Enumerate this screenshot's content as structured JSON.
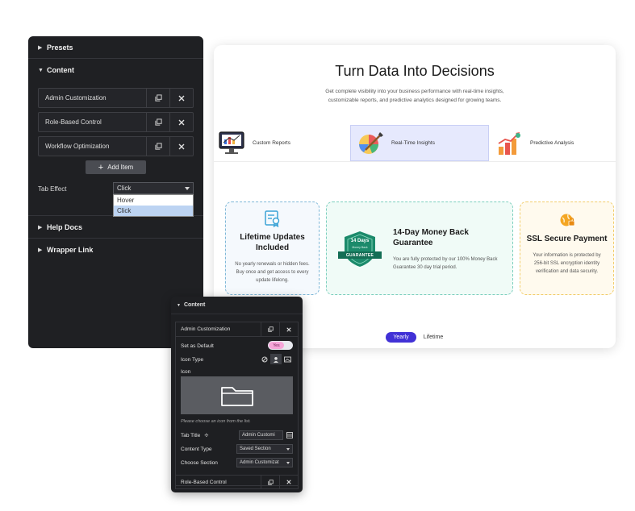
{
  "editor": {
    "sections": {
      "presets": "Presets",
      "content": "Content",
      "help_docs": "Help Docs",
      "wrapper_link": "Wrapper Link"
    },
    "items": [
      {
        "label": "Admin Customization"
      },
      {
        "label": "Role-Based Control"
      },
      {
        "label": "Workflow Optimization"
      }
    ],
    "add_item_label": "Add Item",
    "tab_effect": {
      "label": "Tab Effect",
      "value": "Click",
      "options": [
        "Hover",
        "Click"
      ]
    }
  },
  "preview": {
    "title": "Turn Data Into Decisions",
    "subtitle": "Get complete visibility into your business performance with real-time insights, customizable reports, and predictive analytics designed for growing teams.",
    "tabs": [
      {
        "label": "Custom Reports",
        "icon": "report-icon"
      },
      {
        "label": "Real-Time Insights",
        "icon": "palette-icon"
      },
      {
        "label": "Predictive Analysis",
        "icon": "bar-chart-icon"
      }
    ],
    "cards": [
      {
        "title": "Lifetime Updates Included",
        "text": "No yearly renewals or hidden fees. Buy once and get access to every update lifelong.",
        "icon": "certificate-icon"
      },
      {
        "title": "14-Day Money Back Guarantee",
        "text": "You are fully protected by our 100% Money Back Guarantee 30 day trial period.",
        "badge_top": "14 Days",
        "badge_mid": "Money Back",
        "badge_ribbon": "GUARANTEE"
      },
      {
        "title": "SSL Secure Payment",
        "text": "Your information is protected by 256-bit SSL encryption identity verification and data security.",
        "icon": "secure-globe-icon"
      }
    ],
    "toggle": {
      "yearly": "Yearly",
      "lifetime": "Lifetime"
    }
  },
  "front_panel": {
    "section": "Content",
    "item_open": "Admin Customization",
    "set_default_label": "Set as Default",
    "set_default_value": "Yes",
    "icon_type_label": "Icon Type",
    "icon_label": "Icon",
    "icon_note": "Please choose an icon from the list.",
    "tab_title_label": "Tab Title",
    "tab_title_value": "Admin Customi",
    "content_type_label": "Content Type",
    "content_type_value": "Saved Section",
    "choose_section_label": "Choose Section",
    "choose_section_value": "Admin Customizat",
    "item_next": "Role-Based Control"
  },
  "colors": {
    "panel_bg": "#1f2023",
    "accent_purple": "#4131d6",
    "tab_active_bg": "#e6e9fd",
    "card1_border": "#7fb8d8",
    "card2_border": "#7ccfbe",
    "card3_border": "#f2cd6b"
  }
}
